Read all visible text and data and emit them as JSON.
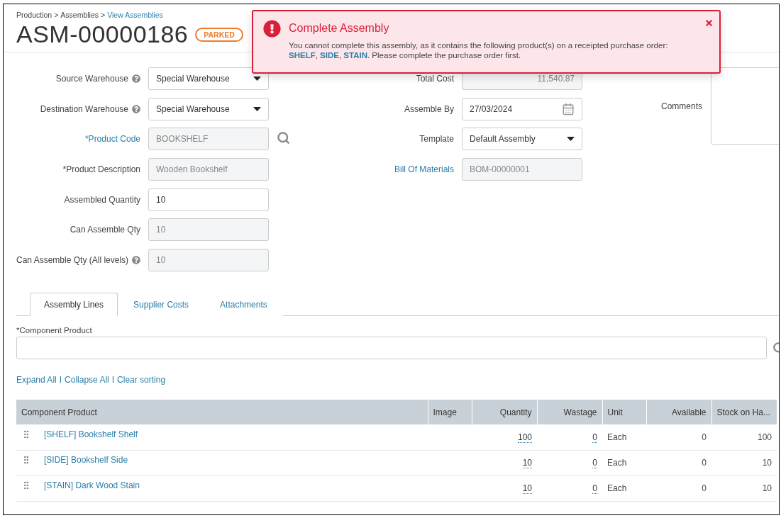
{
  "breadcrumb": {
    "separator": ">",
    "items": [
      {
        "label": "Production",
        "link": false
      },
      {
        "label": "Assemblies",
        "link": false
      },
      {
        "label": "View Assemblies",
        "link": true
      }
    ]
  },
  "title": "ASM-00000186",
  "status": "PARKED",
  "alert": {
    "title": "Complete Assembly",
    "message_start": "You cannot complete this assembly, as it contains the following product(s) on a receipted purchase order:",
    "products": [
      "SHELF",
      "SIDE",
      "STAIN"
    ],
    "product_separator": ",",
    "message_end": ". Please complete the purchase order first."
  },
  "form_left": [
    {
      "label": "Source Warehouse",
      "help": true,
      "link": false,
      "kind": "select",
      "value": "Special Warehouse"
    },
    {
      "label": "Destination Warehouse",
      "help": true,
      "link": false,
      "kind": "select",
      "value": "Special Warehouse"
    },
    {
      "label": "*Product Code",
      "help": false,
      "link": true,
      "kind": "lookup",
      "value": "BOOKSHELF"
    },
    {
      "label": "*Product Description",
      "help": false,
      "link": false,
      "kind": "readonly",
      "value": "Wooden Bookshelf"
    },
    {
      "label": "Assembled Quantity",
      "help": false,
      "link": false,
      "kind": "input",
      "value": "10"
    },
    {
      "label": "Can Assemble Qty",
      "help": false,
      "link": false,
      "kind": "readonly",
      "value": "10"
    },
    {
      "label": "Can Assemble Qty (All levels)",
      "help": true,
      "link": false,
      "kind": "readonly",
      "value": "10"
    }
  ],
  "form_middle": [
    {
      "label": "Total Cost",
      "link": false,
      "kind": "readonly_number",
      "value": "11,540.87"
    },
    {
      "label": "Assemble By",
      "link": false,
      "kind": "date",
      "value": "27/03/2024"
    },
    {
      "label": "Template",
      "link": false,
      "kind": "select",
      "value": "Default Assembly"
    },
    {
      "label": "Bill Of Materials",
      "link": true,
      "kind": "readonly",
      "value": "BOM-00000001"
    }
  ],
  "comments": {
    "label": "Comments"
  },
  "tabs": [
    {
      "label": "Assembly Lines",
      "selected": true
    },
    {
      "label": "Supplier Costs",
      "selected": false
    },
    {
      "label": "Attachments",
      "selected": false
    }
  ],
  "component_field": {
    "label": "*Component Product"
  },
  "tree_links": {
    "separators": [
      "I",
      "I"
    ],
    "items": [
      "Expand All",
      "Collapse All",
      "Clear sorting"
    ]
  },
  "table": {
    "columns": [
      "Component Product",
      "Image",
      "Quantity",
      "Wastage",
      "Unit",
      "Available",
      "Stock on Ha..."
    ],
    "rows": [
      {
        "product": "[SHELF] Bookshelf Shelf",
        "quantity": "100",
        "wastage": "0",
        "unit": "Each",
        "available": "0",
        "stock": "100"
      },
      {
        "product": "[SIDE] Bookshelf Side",
        "quantity": "10",
        "wastage": "0",
        "unit": "Each",
        "available": "0",
        "stock": "10"
      },
      {
        "product": "[STAIN] Dark Wood Stain",
        "quantity": "10",
        "wastage": "0",
        "unit": "Each",
        "available": "0",
        "stock": "10"
      }
    ]
  }
}
